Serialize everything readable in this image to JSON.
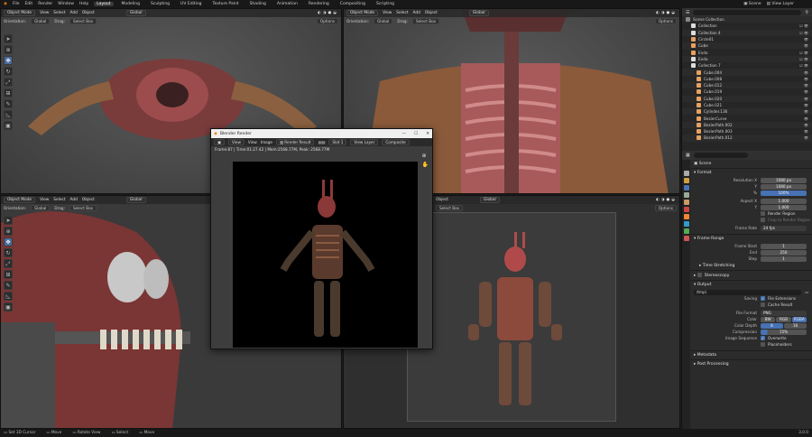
{
  "topbar": {
    "menus": [
      "File",
      "Edit",
      "Render",
      "Window",
      "Help"
    ],
    "workspaces": [
      "Layout",
      "Modeling",
      "Sculpting",
      "UV Editing",
      "Texture Paint",
      "Shading",
      "Animation",
      "Rendering",
      "Compositing",
      "Scripting"
    ],
    "active_workspace": "Layout",
    "scene": "Scene",
    "view_layer": "View Layer"
  },
  "viewport": {
    "mode": "Object Mode",
    "menus": [
      "View",
      "Select",
      "Add",
      "Object"
    ],
    "orientation_label": "Orientation:",
    "orientation": "Global",
    "drag_label": "Drag:",
    "select_box": "Select Box",
    "options": "Options"
  },
  "outliner": {
    "search_placeholder": "",
    "items": [
      "Scene Collection",
      "Collection",
      "Collection 4",
      "Circle01",
      "Cube",
      "Endo",
      "Endo",
      "Collection 7",
      "Cube.004",
      "Cube.008",
      "Cube.012",
      "Cube.019",
      "Cube.020",
      "Cube.021",
      "Cylinder.136",
      "BezierCurve",
      "BezierPath.002",
      "BezierPath.003",
      "BezierPath.012"
    ]
  },
  "properties": {
    "scene_name": "Scene",
    "format_title": "Format",
    "resolution_x_label": "Resolution X",
    "resolution_x": "1080 px",
    "resolution_y_label": "Y",
    "resolution_y": "1080 px",
    "percent_label": "%",
    "percent": "100%",
    "aspect_x_label": "Aspect X",
    "aspect_x": "1.000",
    "aspect_y_label": "Y",
    "aspect_y": "1.000",
    "render_region": "Render Region",
    "crop_region": "Crop to Render Region",
    "frame_rate_label": "Frame Rate",
    "frame_rate": "24 fps",
    "frame_range_title": "Frame Range",
    "frame_start_label": "Frame Start",
    "frame_start": "1",
    "end_label": "End",
    "end": "250",
    "step_label": "Step",
    "step": "1",
    "time_stretching": "Time Stretching",
    "stereoscopy": "Stereoscopy",
    "output_title": "Output",
    "output_path": "/tmp\\",
    "saving_label": "Saving",
    "file_extensions": "File Extensions",
    "cache_result": "Cache Result",
    "file_format_label": "File Format",
    "file_format": "PNG",
    "color_label": "Color",
    "color_bw": "BW",
    "color_rgb": "RGB",
    "color_rgba": "RGBA",
    "color_depth_label": "Color Depth",
    "depth_8": "8",
    "depth_16": "16",
    "compression_label": "Compression",
    "compression": "15%",
    "image_sequence_label": "Image Sequence",
    "overwrite": "Overwrite",
    "placeholders": "Placeholders",
    "metadata": "Metadata",
    "post_processing": "Post Processing"
  },
  "render_window": {
    "title": "Blender Render",
    "menus": [
      "View",
      "View",
      "Image"
    ],
    "image_name": "Render Result",
    "slot": "Slot 1",
    "view_layer": "View Layer",
    "combined": "Composite",
    "info": "Frame:87 | Time:01:27.42 | Mem:2568.77M, Peak: 2568.77M"
  },
  "statusbar": {
    "items": [
      "Set 3D Cursor",
      "Move",
      "Rotate View",
      "Select",
      "Move"
    ],
    "version": "3.0.0"
  },
  "colors": {
    "accent": "#4772b3",
    "header": "#303030",
    "panel": "#2b2b2b"
  }
}
